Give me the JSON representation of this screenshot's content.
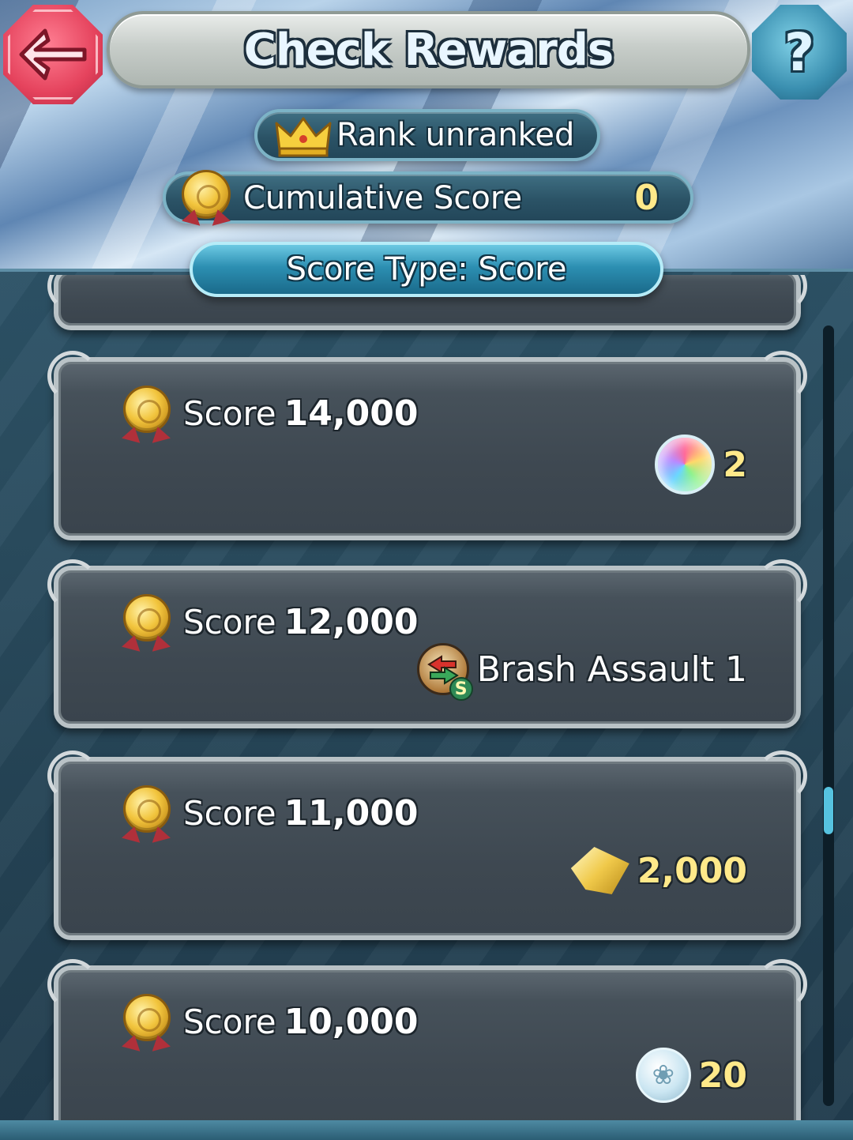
{
  "header": {
    "title": "Check Rewards",
    "back_icon": "back-arrow-icon",
    "help_label": "?"
  },
  "rank": {
    "icon": "crown-icon",
    "label": "Rank  unranked"
  },
  "cumulative": {
    "icon": "score-medal-icon",
    "label": "Cumulative Score",
    "value": "0"
  },
  "score_type": {
    "label": "Score Type: Score"
  },
  "rewards": [
    {
      "score_label": "Score",
      "score_value": "14,000",
      "reward_icon": "orb-icon",
      "reward_text": "2"
    },
    {
      "score_label": "Score",
      "score_value": "12,000",
      "reward_icon": "skill-icon",
      "reward_text": "Brash Assault 1"
    },
    {
      "score_label": "Score",
      "score_value": "11,000",
      "reward_icon": "crystal-icon",
      "reward_text": "2,000"
    },
    {
      "score_label": "Score",
      "score_value": "10,000",
      "reward_icon": "feather-icon",
      "reward_text": "20"
    }
  ],
  "colors": {
    "accent_gold": "#ffe98a",
    "back_button": "#e5435d",
    "help_button": "#3a8fb0",
    "score_type_bar": "#2c8fb2"
  }
}
